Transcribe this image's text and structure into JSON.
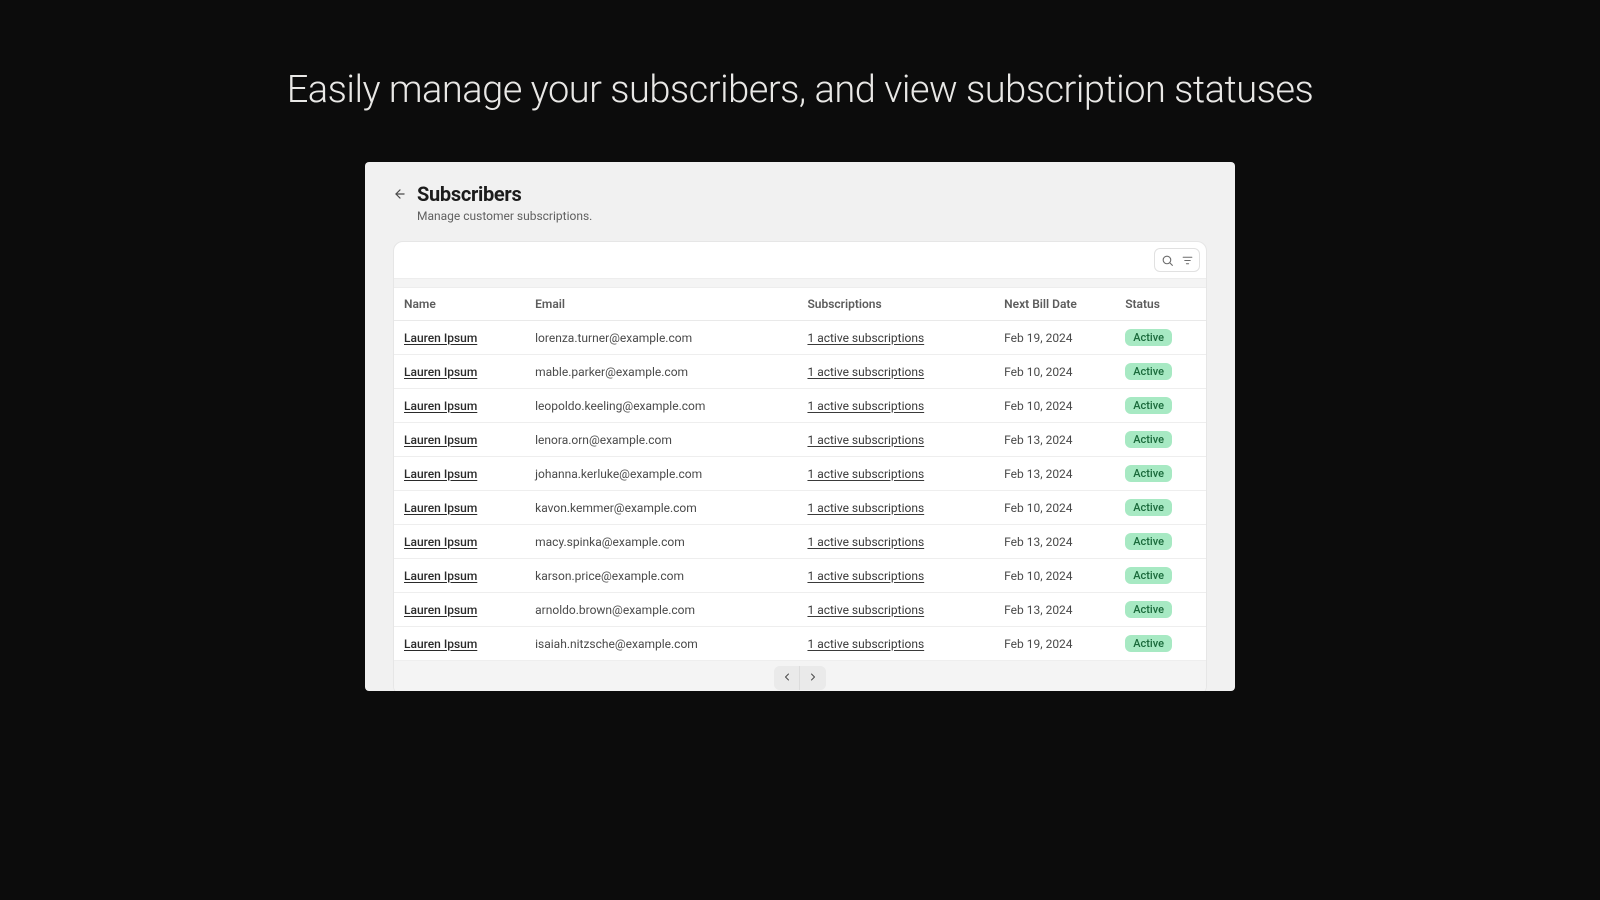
{
  "hero": "Easily manage your subscribers, and view subscription statuses",
  "header": {
    "title": "Subscribers",
    "subtitle": "Manage customer subscriptions."
  },
  "columns": {
    "name": "Name",
    "email": "Email",
    "subscriptions": "Subscriptions",
    "next_bill": "Next Bill Date",
    "status": "Status"
  },
  "status_label": "Active",
  "rows": [
    {
      "name": "Lauren Ipsum",
      "email": "lorenza.turner@example.com",
      "subs": "1 active subscriptions",
      "date": "Feb 19, 2024"
    },
    {
      "name": "Lauren Ipsum",
      "email": "mable.parker@example.com",
      "subs": "1 active subscriptions",
      "date": "Feb 10, 2024"
    },
    {
      "name": "Lauren Ipsum",
      "email": "leopoldo.keeling@example.com",
      "subs": "1 active subscriptions",
      "date": "Feb 10, 2024"
    },
    {
      "name": "Lauren Ipsum",
      "email": "lenora.orn@example.com",
      "subs": "1 active subscriptions",
      "date": "Feb 13, 2024"
    },
    {
      "name": "Lauren Ipsum",
      "email": "johanna.kerluke@example.com",
      "subs": "1 active subscriptions",
      "date": "Feb 13, 2024"
    },
    {
      "name": "Lauren Ipsum",
      "email": "kavon.kemmer@example.com",
      "subs": "1 active subscriptions",
      "date": "Feb 10, 2024"
    },
    {
      "name": "Lauren Ipsum",
      "email": "macy.spinka@example.com",
      "subs": "1 active subscriptions",
      "date": "Feb 13, 2024"
    },
    {
      "name": "Lauren Ipsum",
      "email": "karson.price@example.com",
      "subs": "1 active subscriptions",
      "date": "Feb 10, 2024"
    },
    {
      "name": "Lauren Ipsum",
      "email": "arnoldo.brown@example.com",
      "subs": "1 active subscriptions",
      "date": "Feb 13, 2024"
    },
    {
      "name": "Lauren Ipsum",
      "email": "isaiah.nitzsche@example.com",
      "subs": "1 active subscriptions",
      "date": "Feb 19, 2024"
    }
  ]
}
